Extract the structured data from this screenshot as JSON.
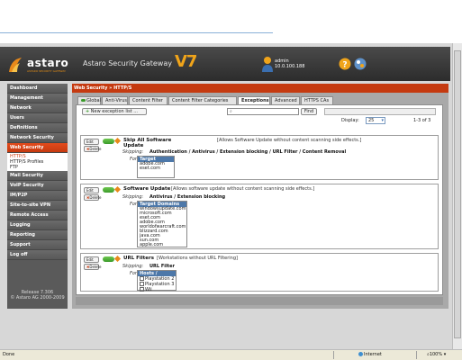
{
  "app": {
    "product_name": "Astaro Security Gateway",
    "version_mark": "V7",
    "logo_word": "astaro",
    "logo_tagline": "ASTARO SECURITY GATEWAY",
    "user_name": "admin",
    "user_host": "10.0.100.188"
  },
  "sidebar": {
    "items": [
      "Dashboard",
      "Management",
      "Network",
      "Users",
      "Definitions",
      "Network Security",
      "Web Security",
      "Mail Security",
      "VoIP Security",
      "IM/P2P",
      "Site-to-site VPN",
      "Remote Access",
      "Logging",
      "Reporting",
      "Support",
      "Log off"
    ],
    "subitems": [
      "HTTP/S",
      "HTTP/S Profiles",
      "FTP"
    ],
    "release_line1": "Release 7.306",
    "release_line2": "© Astaro AG 2000-2009"
  },
  "breadcrumb": "Web Security » HTTP/S",
  "tabs": [
    "Global",
    "Anti-Virus",
    "Content Filter",
    "Content Filter Categories",
    "Exceptions",
    "Advanced",
    "HTTPS CAs"
  ],
  "toolbar": {
    "new_label": "New exception list ...",
    "search_value": "",
    "find_label": "Find",
    "display_label": "Display:",
    "display_value": "25",
    "range_text": "1-3 of 3"
  },
  "rules": [
    {
      "edit": "Edit",
      "delete": "Delete",
      "title": "Skip All Software Update",
      "description": "[Allows Software Update without content scanning side effects.]",
      "skipping_label": "Skipping:",
      "skipping": "Authentication / Antivirus / Extension blocking / URL Filter / Content Removal",
      "for_label": "For:",
      "list_header": "Target Domains",
      "entries": [
        "adobe.com",
        "eset.com"
      ]
    },
    {
      "edit": "Edit",
      "delete": "Delete",
      "title": "Software Update",
      "description": "[Allows software update without content scanning side effects.]",
      "skipping_label": "Skipping:",
      "skipping": "Antivirus / Extension blocking",
      "for_label": "For:",
      "list_header": "Target Domains",
      "entries": [
        "windowsupdate.com",
        "microsoft.com",
        "eset.com",
        "adobe.com",
        "worldofwarcraft.com",
        "blizzard.com",
        "java.com",
        "sun.com",
        "apple.com"
      ]
    },
    {
      "edit": "Edit",
      "delete": "Delete",
      "title": "URL Filters",
      "description": "[Workstations without URL Filtering]",
      "skipping_label": "Skipping:",
      "skipping": "URL Filter",
      "for_label": "For:",
      "list_header": "Hosts / Networks",
      "entries": [
        "Playstation 2",
        "Playstation 3",
        "Wii"
      ]
    }
  ],
  "statusbar": {
    "left": "Done",
    "zone": "Internet",
    "zoom": "100%"
  },
  "colors": {
    "accent": "#c53a10",
    "header": "#2c2c2c",
    "list_header": "#4d78a9",
    "toggle_on": "#3a9a2a"
  }
}
